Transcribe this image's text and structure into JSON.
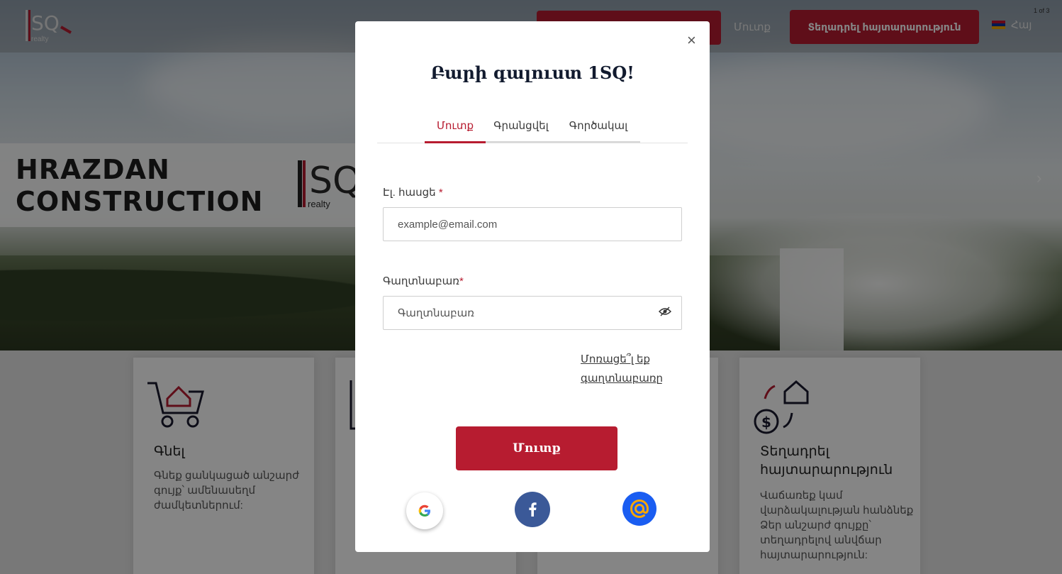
{
  "header": {
    "nav_login": "Մուտք",
    "post_ad_label": "Տեղադրել հայտարարություն",
    "language": "Հայ",
    "slide_counter": "1 of 3"
  },
  "banner": {
    "line1": "HRAZDAN",
    "line2": "CONSTRUCTION",
    "logo_sub": "realty"
  },
  "logo": {
    "text": "1SQ",
    "sub": "realty"
  },
  "cards": [
    {
      "title": "Գնել",
      "desc": [
        "Գնեք ցանկացած անշարժ",
        "գույք՝ ամենասեղմ",
        "ժամկետներում:"
      ]
    },
    {
      "title": "Տեղադրել\nհայտարարություն",
      "title_lines": [
        "Տեղադրել",
        "հայտարարություն"
      ],
      "desc": [
        "Վաճառեք կամ",
        "վարձակալության հանձնեք",
        "Ձեր անշարժ գույքը՝",
        "տեղադրելով անվճար",
        "հայտարարություն:"
      ]
    }
  ],
  "modal": {
    "close": "×",
    "title": "Բարի գալուստ 1SQ!",
    "tabs": [
      {
        "label": "Մուտք",
        "active": true
      },
      {
        "label": "Գրանցվել",
        "active": false
      },
      {
        "label": "Գործակալ",
        "active": false
      }
    ],
    "email_label": "Էլ. հասցե",
    "email_placeholder": "example@email.com",
    "password_label": "Գաղտնաբառ",
    "password_placeholder": "Գաղտնաբառ",
    "required_mark": "*",
    "forgot_password": "Մոռացե՞լ եք գաղտնաբառը",
    "submit_label": "Մուտք"
  },
  "colors": {
    "accent": "#b71c30",
    "facebook": "#3b5998",
    "mail": "#1a5df1"
  },
  "icons": [
    "close-icon",
    "eye-slash-icon",
    "google-icon",
    "facebook-icon",
    "at-sign-icon",
    "cart-house-icon",
    "exchange-house-icon",
    "armenian-flag-icon"
  ]
}
